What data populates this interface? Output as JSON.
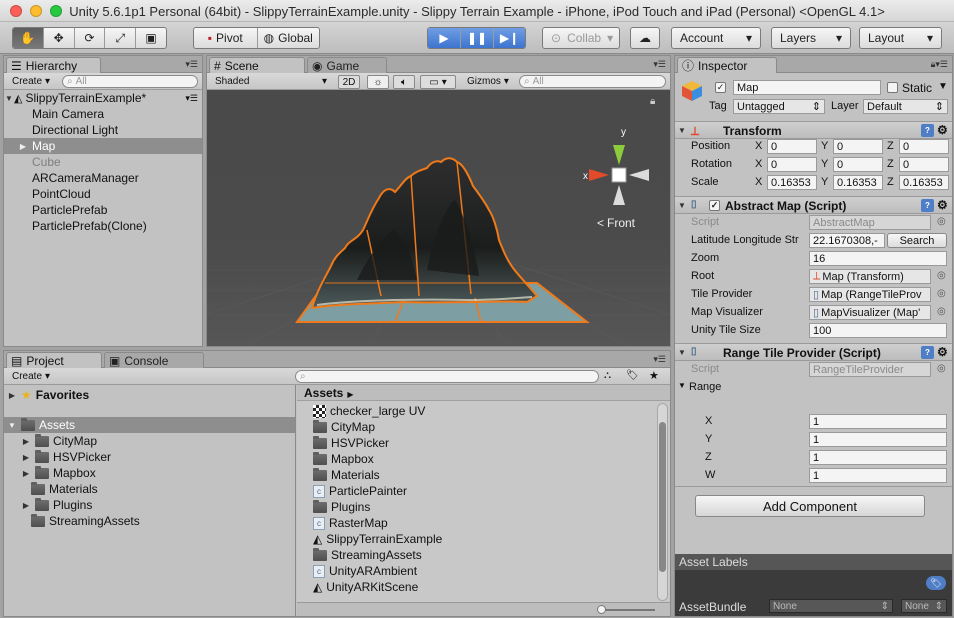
{
  "window": {
    "title": "Unity 5.6.1p1 Personal (64bit) - SlippyTerrainExample.unity - Slippy Terrain Example - iPhone, iPod Touch and iPad (Personal) <OpenGL 4.1>",
    "light_colors": [
      "#fc5f57",
      "#fdbc2e",
      "#28c840"
    ]
  },
  "toolbar": {
    "pivot_label": "Pivot",
    "global_label": "Global",
    "collab_label": "Collab",
    "account_label": "Account",
    "layers_label": "Layers",
    "layout_label": "Layout",
    "transform_tools": [
      "hand-icon",
      "move-icon",
      "rotate-icon",
      "scale-icon",
      "rect-icon"
    ],
    "playback": [
      "play-icon",
      "pause-icon",
      "step-icon"
    ]
  },
  "hierarchy": {
    "tab_label": "Hierarchy",
    "create_label": "Create",
    "search_placeholder": "All",
    "scene_name": "SlippyTerrainExample*",
    "items": [
      {
        "label": "Main Camera",
        "state": "normal"
      },
      {
        "label": "Directional Light",
        "state": "normal"
      },
      {
        "label": "Map",
        "state": "selected"
      },
      {
        "label": "Cube",
        "state": "disabled"
      },
      {
        "label": "ARCameraManager",
        "state": "normal"
      },
      {
        "label": "PointCloud",
        "state": "normal"
      },
      {
        "label": "ParticlePrefab",
        "state": "normal"
      },
      {
        "label": "ParticlePrefab(Clone)",
        "state": "normal"
      }
    ]
  },
  "scene": {
    "tab_label": "Scene",
    "game_tab_label": "Game",
    "shading_mode": "Shaded",
    "mode_2d_label": "2D",
    "gizmos_label": "Gizmos",
    "search_placeholder": "All",
    "view_label": "Front",
    "axis_x": "x",
    "axis_y": "y",
    "outline_color": "#f07a1a"
  },
  "inspector": {
    "tab_label": "Inspector",
    "object_name": "Map",
    "static_label": "Static",
    "tag_label": "Tag",
    "tag_value": "Untagged",
    "layer_label": "Layer",
    "layer_value": "Default",
    "transform": {
      "title": "Transform",
      "position_label": "Position",
      "rotation_label": "Rotation",
      "scale_label": "Scale",
      "position": [
        "0",
        "0",
        "0"
      ],
      "rotation": [
        "0",
        "0",
        "0"
      ],
      "scale": [
        "0.16353",
        "0.16353",
        "0.16353"
      ],
      "axis_x": "X",
      "axis_y": "Y",
      "axis_z": "Z"
    },
    "abstract_map": {
      "title": "Abstract Map (Script)",
      "script_label": "Script",
      "script_value": "AbstractMap",
      "latlon_label": "Latitude Longitude Str",
      "latlon_value": "22.1670308,-",
      "search_button": "Search",
      "zoom_label": "Zoom",
      "zoom_value": "16",
      "root_label": "Root",
      "root_value": "Map (Transform)",
      "tile_provider_label": "Tile Provider",
      "tile_provider_value": "Map (RangeTileProv",
      "map_visualizer_label": "Map Visualizer",
      "map_visualizer_value": "MapVisualizer (Map'",
      "unity_tile_size_label": "Unity Tile Size",
      "unity_tile_size_value": "100"
    },
    "range_tile_provider": {
      "title": "Range Tile Provider (Script)",
      "script_label": "Script",
      "script_value": "RangeTileProvider",
      "range_label": "Range",
      "x_label": "X",
      "x_value": "1",
      "y_label": "Y",
      "y_value": "1",
      "z_label": "Z",
      "z_value": "1",
      "w_label": "W",
      "w_value": "1"
    },
    "add_component_label": "Add Component",
    "asset_labels_label": "Asset Labels",
    "asset_bundle_label": "AssetBundle",
    "asset_bundle_value": "None",
    "asset_bundle_variant": "None"
  },
  "project": {
    "tab_label": "Project",
    "console_tab_label": "Console",
    "create_label": "Create",
    "favorites_label": "Favorites",
    "assets_label": "Assets",
    "folders": [
      "CityMap",
      "HSVPicker",
      "Mapbox",
      "Materials",
      "Plugins",
      "StreamingAssets"
    ],
    "breadcrumb": "Assets",
    "files": [
      {
        "label": "checker_large UV",
        "icon": "checker-icon"
      },
      {
        "label": "CityMap",
        "icon": "folder-icon"
      },
      {
        "label": "HSVPicker",
        "icon": "folder-icon"
      },
      {
        "label": "Mapbox",
        "icon": "folder-icon"
      },
      {
        "label": "Materials",
        "icon": "folder-icon"
      },
      {
        "label": "ParticlePainter",
        "icon": "script-icon"
      },
      {
        "label": "Plugins",
        "icon": "folder-icon"
      },
      {
        "label": "RasterMap",
        "icon": "script-icon"
      },
      {
        "label": "SlippyTerrainExample",
        "icon": "unity-scene-icon"
      },
      {
        "label": "StreamingAssets",
        "icon": "folder-icon"
      },
      {
        "label": "UnityARAmbient",
        "icon": "script-icon"
      },
      {
        "label": "UnityARKitScene",
        "icon": "unity-scene-icon"
      }
    ]
  }
}
